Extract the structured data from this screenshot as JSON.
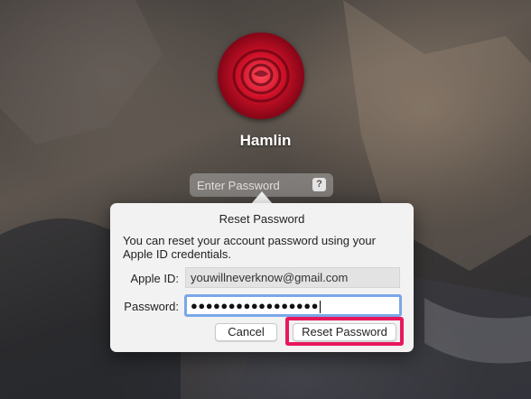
{
  "login": {
    "user_name": "Hamlin",
    "password_placeholder": "Enter Password",
    "hint_icon": "?"
  },
  "dialog": {
    "title": "Reset Password",
    "message": "You can reset your account password using your Apple ID credentials.",
    "apple_id_label": "Apple ID:",
    "apple_id_value": "youwillneverknow@gmail.com",
    "password_label": "Password:",
    "password_value": "●●●●●●●●●●●●●●●●●",
    "cancel_label": "Cancel",
    "reset_label": "Reset Password"
  },
  "colors": {
    "highlight": "#e8175d",
    "focus_ring": "#7aa7e8"
  }
}
